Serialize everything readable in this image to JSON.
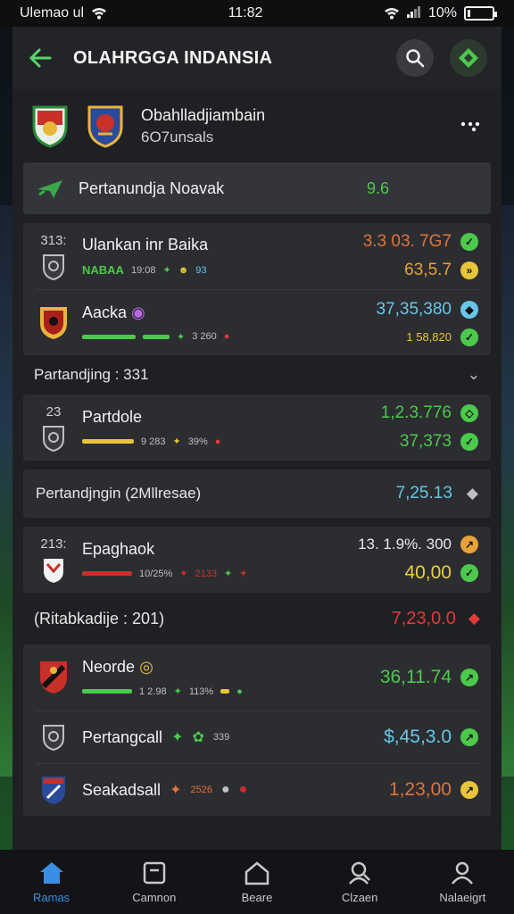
{
  "status": {
    "left_text": "Ulemao ul",
    "time": "11:82",
    "battery": "10%"
  },
  "header": {
    "title": "OLAHRGGA INDANSIA"
  },
  "match": {
    "title": "Obahlladjiambain",
    "subtitle": "6O7unsals"
  },
  "banner": {
    "label": "Pertanundja Noavak",
    "value": "9.6"
  },
  "rows": [
    {
      "num": "313:",
      "name": "Ulankan inr Baika",
      "mini": "NABAA",
      "mini2": "19:08",
      "mini3": "93",
      "value1": "3.3 03. 7G7",
      "value1_color": "#e0743a",
      "value2": "63,5.7",
      "value2_color": "#e8a23a"
    },
    {
      "num": "",
      "name": "Aacka",
      "mini": "3 260",
      "value1": "37,35,380",
      "value1_color": "#66c7e8",
      "value2": "1 58,820",
      "value2_color": "#e8c43a"
    }
  ],
  "section1": {
    "label": "Partandjing : 331"
  },
  "rows2": [
    {
      "num": "23",
      "name": "Partdole",
      "mini": "9 283",
      "mini2": "39%",
      "value1": "1,2.3.776",
      "value1_color": "#4cc94c",
      "value2": "37,373",
      "value2_color": "#4cc94c"
    }
  ],
  "section2": {
    "label": "Pertandjngin (2Mllresae)",
    "value": "7,25.13"
  },
  "rows3": [
    {
      "num": "213:",
      "name": "Epaghaok",
      "mini": "10/25%",
      "mini2": "2133",
      "value1": "13. 1.9%. 300",
      "value1_color": "#e8c43a",
      "value2": "40,00",
      "value2_color": "#e8d23a"
    }
  ],
  "section3": {
    "label": "(Ritabkadije : 201)",
    "value": "7,23,0.0"
  },
  "rows4": [
    {
      "name": "Neorde",
      "mini": "1 2.98",
      "mini2": "113%",
      "value": "36,11.74",
      "value_color": "#4cc94c"
    },
    {
      "name": "Pertangcall",
      "mini": "339",
      "value": "$,45,3.0",
      "value_color": "#66c7e8"
    },
    {
      "name": "Seakadsall",
      "mini": "2526",
      "value": "1,23,00",
      "value_color": "#e0743a"
    }
  ],
  "nav": [
    {
      "label": "Ramas",
      "icon": "home-icon"
    },
    {
      "label": "Camnon",
      "icon": "calendar-icon"
    },
    {
      "label": "Beare",
      "icon": "house-icon"
    },
    {
      "label": "Clzaen",
      "icon": "user-search-icon"
    },
    {
      "label": "Nalaeigrt",
      "icon": "profile-icon"
    }
  ]
}
